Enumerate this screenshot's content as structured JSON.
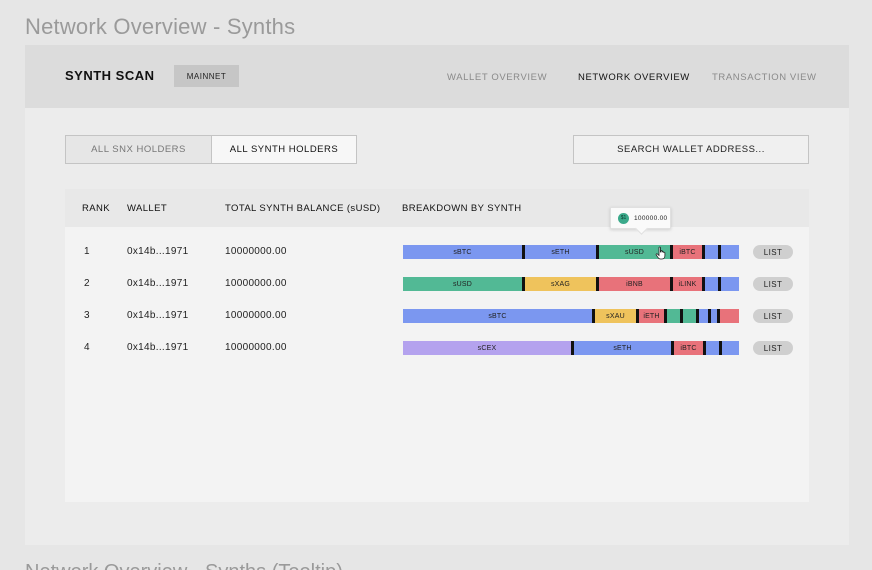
{
  "page_title": "Network Overview - Synths",
  "footer_title": "Network Overview - Synths (Tooltip)",
  "header": {
    "brand": "SYNTH SCAN",
    "network_badge": "MAINNET",
    "nav": [
      {
        "label": "WALLET OVERVIEW",
        "active": false
      },
      {
        "label": "NETWORK OVERVIEW",
        "active": true
      },
      {
        "label": "TRANSACTION VIEW",
        "active": false
      }
    ]
  },
  "tabs": [
    {
      "label": "ALL SNX HOLDERS",
      "active": false
    },
    {
      "label": "ALL SYNTH HOLDERS",
      "active": true
    }
  ],
  "search": {
    "label": "SEARCH WALLET ADDRESS..."
  },
  "table": {
    "columns": [
      "RANK",
      "WALLET",
      "TOTAL SYNTH BALANCE (sUSD)",
      "BREAKDOWN BY SYNTH"
    ],
    "list_label": "LIST",
    "rows": [
      {
        "rank": "1",
        "wallet": "0x14b...1971",
        "balance": "10000000.00",
        "breakdown": [
          {
            "label": "sBTC",
            "share": 0.37,
            "color": "#7b97f0"
          },
          {
            "label": "sETH",
            "share": 0.22,
            "color": "#7b97f0"
          },
          {
            "label": "sUSD",
            "share": 0.22,
            "color": "#52b995"
          },
          {
            "label": "iBTC",
            "share": 0.09,
            "color": "#e8727a"
          },
          {
            "label": "",
            "share": 0.04,
            "color": "#7b97f0"
          },
          {
            "label": "",
            "share": 0.03,
            "color": "#7b97f0"
          }
        ]
      },
      {
        "rank": "2",
        "wallet": "0x14b...1971",
        "balance": "10000000.00",
        "breakdown": [
          {
            "label": "sUSD",
            "share": 0.37,
            "color": "#52b995"
          },
          {
            "label": "sXAG",
            "share": 0.22,
            "color": "#efc35c"
          },
          {
            "label": "iBNB",
            "share": 0.22,
            "color": "#e8727a"
          },
          {
            "label": "iLINK",
            "share": 0.09,
            "color": "#e8727a"
          },
          {
            "label": "",
            "share": 0.04,
            "color": "#7b97f0"
          },
          {
            "label": "",
            "share": 0.03,
            "color": "#7b97f0"
          }
        ]
      },
      {
        "rank": "3",
        "wallet": "0x14b...1971",
        "balance": "10000000.00",
        "breakdown": [
          {
            "label": "sBTC",
            "share": 0.6,
            "color": "#7b97f0"
          },
          {
            "label": "sXAU",
            "share": 0.13,
            "color": "#efc35c"
          },
          {
            "label": "iETH",
            "share": 0.08,
            "color": "#e8727a"
          },
          {
            "label": "",
            "share": 0.04,
            "color": "#52b995"
          },
          {
            "label": "",
            "share": 0.04,
            "color": "#52b995"
          },
          {
            "label": "",
            "share": 0.03,
            "color": "#7b97f0"
          },
          {
            "label": "",
            "share": 0.02,
            "color": "#7b97f0"
          },
          {
            "label": "",
            "share": 0.02,
            "color": "#e8727a"
          }
        ]
      },
      {
        "rank": "4",
        "wallet": "0x14b...1971",
        "balance": "10000000.00",
        "breakdown": [
          {
            "label": "sCEX",
            "share": 0.52,
            "color": "#b4a2ee"
          },
          {
            "label": "sETH",
            "share": 0.3,
            "color": "#7b97f0"
          },
          {
            "label": "iBTC",
            "share": 0.09,
            "color": "#e8727a"
          },
          {
            "label": "",
            "share": 0.04,
            "color": "#7b97f0"
          },
          {
            "label": "",
            "share": 0.03,
            "color": "#7b97f0"
          }
        ]
      }
    ]
  },
  "tooltip": {
    "icon_text": "$1",
    "value": "100000.00",
    "icon": "synth-coin-icon"
  }
}
